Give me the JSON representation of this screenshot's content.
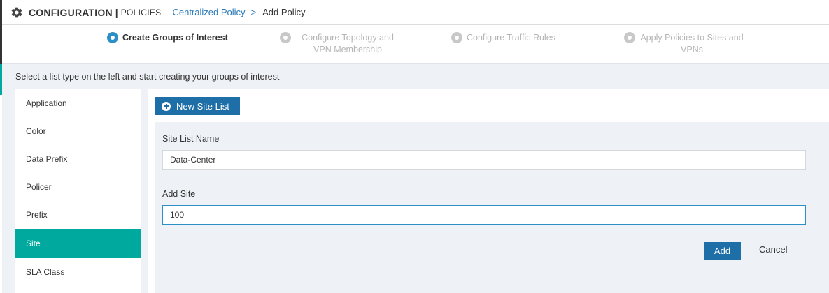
{
  "header": {
    "title": "CONFIGURATION",
    "separator": "|",
    "section": "POLICIES",
    "breadcrumb": {
      "link": "Centralized Policy",
      "separator": ">",
      "current": "Add Policy"
    }
  },
  "stepper": {
    "steps": [
      {
        "label": "Create Groups of Interest",
        "state": "active"
      },
      {
        "label": "Configure Topology and VPN Membership",
        "state": "inactive"
      },
      {
        "label": "Configure Traffic Rules",
        "state": "inactive"
      },
      {
        "label": "Apply Policies to Sites and VPNs",
        "state": "inactive"
      }
    ]
  },
  "instruction": "Select a list type on the left and start creating your groups of interest",
  "sidebar": {
    "items": [
      {
        "label": "Application"
      },
      {
        "label": "Color"
      },
      {
        "label": "Data Prefix"
      },
      {
        "label": "Policer"
      },
      {
        "label": "Prefix"
      },
      {
        "label": "Site",
        "active": true
      },
      {
        "label": "SLA Class"
      }
    ]
  },
  "main": {
    "new_button_label": "New Site List",
    "form": {
      "name_label": "Site List Name",
      "name_value": "Data-Center",
      "site_label": "Add Site",
      "site_value": "100",
      "add_label": "Add",
      "cancel_label": "Cancel"
    }
  },
  "colors": {
    "accent_blue": "#1e6fa8",
    "link_blue": "#2a7ab8",
    "teal_active": "#00a99d",
    "panel_bg": "#eef1f5"
  },
  "icons": {
    "settings": "gear-icon",
    "new": "plus-circle-icon"
  }
}
